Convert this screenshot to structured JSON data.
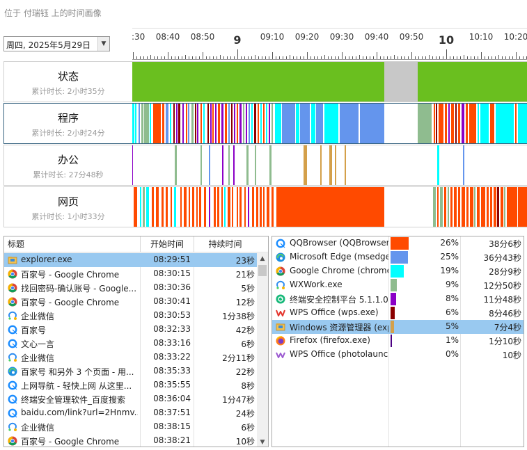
{
  "window": {
    "title": "位于 付瑞钰 上的时间画像"
  },
  "date_picker": {
    "value": "周四, 2025年5月29日",
    "arrow_icon": "chevron-down-icon"
  },
  "ruler": {
    "labels": [
      "08:30",
      "08:40",
      "08:50",
      "9",
      "09:10",
      "09:20",
      "09:30",
      "09:40",
      "09:50",
      "10",
      "10:10",
      "10:20"
    ],
    "hour_labels": [
      "9",
      "10"
    ]
  },
  "rows": [
    {
      "id": "status",
      "title": "状态",
      "subtitle": "累计时长: 2小时35分"
    },
    {
      "id": "program",
      "title": "程序",
      "subtitle": "累计时长: 2小时24分",
      "selected": true
    },
    {
      "id": "office",
      "title": "办公",
      "subtitle": "累计时长: 27分48秒"
    },
    {
      "id": "web",
      "title": "网页",
      "subtitle": "累计时长: 1小时33分"
    }
  ],
  "colors": {
    "active_green": "#6abf1f",
    "idle_gray": "#c8c8c8",
    "qqbrowser": "#ff4a00",
    "edge": "#6495ed",
    "chrome": "#00ffff",
    "wxwork": "#8fbc8f",
    "security": "#8b00c6",
    "wps": "#8b0000",
    "explorer": "#d4a04a",
    "firefox": "#4b0082",
    "selection": "#99c9f0"
  },
  "event_table": {
    "headers": {
      "title": "标题",
      "start": "开始时间",
      "duration": "持续时间"
    },
    "rows": [
      {
        "icon": "folder-icon",
        "title": "explorer.exe",
        "start": "08:29:51",
        "duration": "23秒",
        "selected": true
      },
      {
        "icon": "chrome-icon",
        "title": "百家号 - Google Chrome",
        "start": "08:30:15",
        "duration": "21秒"
      },
      {
        "icon": "chrome-icon",
        "title": "找回密码-确认账号 - Google...",
        "start": "08:30:36",
        "duration": "5秒"
      },
      {
        "icon": "chrome-icon",
        "title": "百家号 - Google Chrome",
        "start": "08:30:41",
        "duration": "12秒"
      },
      {
        "icon": "wxwork-icon",
        "title": "企业微信",
        "start": "08:30:53",
        "duration": "1分38秒"
      },
      {
        "icon": "qqbrowser-icon",
        "title": "百家号",
        "start": "08:32:33",
        "duration": "42秒"
      },
      {
        "icon": "qqbrowser-icon",
        "title": "文心一言",
        "start": "08:33:16",
        "duration": "6秒"
      },
      {
        "icon": "wxwork-icon",
        "title": "企业微信",
        "start": "08:33:22",
        "duration": "2分11秒"
      },
      {
        "icon": "edge-icon",
        "title": "百家号 和另外 3 个页面 - 用...",
        "start": "08:35:33",
        "duration": "22秒"
      },
      {
        "icon": "qqbrowser-icon",
        "title": "上网导航 - 轻快上网 从这里...",
        "start": "08:35:55",
        "duration": "8秒"
      },
      {
        "icon": "qqbrowser-icon",
        "title": "终端安全管理软件_百度搜索",
        "start": "08:36:04",
        "duration": "1分47秒"
      },
      {
        "icon": "qqbrowser-icon",
        "title": "baidu.com/link?url=2Hnmv...",
        "start": "08:37:51",
        "duration": "24秒"
      },
      {
        "icon": "wxwork-icon",
        "title": "企业微信",
        "start": "08:38:15",
        "duration": "6秒"
      },
      {
        "icon": "chrome-icon",
        "title": "百家号 - Google Chrome",
        "start": "08:38:21",
        "duration": "10秒"
      }
    ]
  },
  "app_table": {
    "rows": [
      {
        "icon": "qqbrowser-icon",
        "name": "QQBrowser (QQBrowser.exe)",
        "share": 26,
        "percent": "26%",
        "duration": "38分6秒",
        "color": "#ff4a00"
      },
      {
        "icon": "edge-icon",
        "name": "Microsoft Edge (msedge.exe)",
        "share": 25,
        "percent": "25%",
        "duration": "36分43秒",
        "color": "#6495ed"
      },
      {
        "icon": "chrome-icon",
        "name": "Google Chrome (chrome.exe)",
        "share": 19,
        "percent": "19%",
        "duration": "28分9秒",
        "color": "#00ffff"
      },
      {
        "icon": "wxwork-icon",
        "name": "WXWork.exe",
        "share": 9,
        "percent": "9%",
        "duration": "12分50秒",
        "color": "#8fbc8f"
      },
      {
        "icon": "security-icon",
        "name": "终端安全控制平台 5.1.1.0 (...)",
        "share": 8,
        "percent": "8%",
        "duration": "11分48秒",
        "color": "#8b00c6"
      },
      {
        "icon": "wps-icon",
        "name": "WPS Office (wps.exe)",
        "share": 6,
        "percent": "6%",
        "duration": "8分46秒",
        "color": "#8b0000"
      },
      {
        "icon": "folder-icon",
        "name": "Windows 资源管理器 (explorer.exe)",
        "share": 5,
        "percent": "5%",
        "duration": "7分4秒",
        "color": "#d4a04a",
        "selected": true
      },
      {
        "icon": "firefox-icon",
        "name": "Firefox (firefox.exe)",
        "share": 1,
        "percent": "1%",
        "duration": "1分10秒",
        "color": "#4b0082"
      },
      {
        "icon": "wps-photo-icon",
        "name": "WPS Office (photolaunch.exe)",
        "share": 0,
        "percent": "0%",
        "duration": "10秒",
        "color": "#9b59d0"
      }
    ]
  }
}
